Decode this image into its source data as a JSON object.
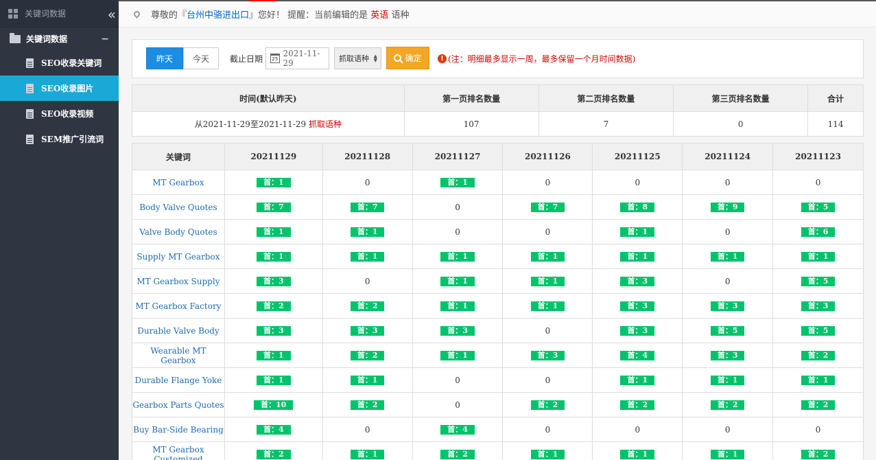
{
  "sidebar": {
    "header_title": "关键词数据",
    "collapse_glyph": "«",
    "group_label": "关键词数据",
    "group_toggle": "−",
    "items": [
      {
        "label": "SEO收录关键词",
        "active": false
      },
      {
        "label": "SEO收录图片",
        "active": true
      },
      {
        "label": "SEO收录视频",
        "active": false
      },
      {
        "label": "SEM推广引流词",
        "active": false
      }
    ]
  },
  "topbar": {
    "greeting_prefix": "尊敬的『",
    "company": "台州中骆进出口",
    "greeting_suffix": "』您好！ 提醒：当前编辑的是 ",
    "language": "英语",
    "language_suffix": " 语种"
  },
  "filter": {
    "yesterday_label": "昨天",
    "today_label": "今天",
    "date_label": "截止日期",
    "date_value": "2021-11-29",
    "calendar_icon_text": "25",
    "select_value": "抓取语种",
    "confirm_label": "确定",
    "note": "(注：明细最多显示一周，最多保留一个月时间数据)"
  },
  "summary": {
    "headers": [
      "时间(默认昨天)",
      "第一页排名数量",
      "第二页排名数量",
      "第三页排名数量",
      "合计"
    ],
    "period_text": "从2021-11-29至2021-11-29 ",
    "period_link": "抓取语种",
    "values": [
      "107",
      "7",
      "0",
      "114"
    ]
  },
  "detail": {
    "headers": [
      "关键词",
      "20211129",
      "20211128",
      "20211127",
      "20211126",
      "20211125",
      "20211124",
      "20211123"
    ],
    "rows": [
      {
        "keyword": "MT Gearbox",
        "cells": [
          "首：1",
          "0",
          "首：1",
          "0",
          "0",
          "0",
          "0"
        ]
      },
      {
        "keyword": "Body Valve Quotes",
        "cells": [
          "首：7",
          "首：7",
          "0",
          "首：7",
          "首：8",
          "首：9",
          "首：5"
        ]
      },
      {
        "keyword": "Valve Body Quotes",
        "cells": [
          "首：1",
          "首：1",
          "0",
          "0",
          "首：1",
          "0",
          "首：6"
        ]
      },
      {
        "keyword": "Supply MT Gearbox",
        "cells": [
          "首：1",
          "首：1",
          "首：1",
          "首：1",
          "首：1",
          "首：1",
          "首：1"
        ]
      },
      {
        "keyword": "MT Gearbox Supply",
        "cells": [
          "首：3",
          "0",
          "首：1",
          "首：1",
          "首：3",
          "0",
          "首：5"
        ]
      },
      {
        "keyword": "MT Gearbox Factory",
        "cells": [
          "首：2",
          "首：2",
          "首：1",
          "首：1",
          "首：3",
          "首：3",
          "首：3"
        ]
      },
      {
        "keyword": "Durable Valve Body",
        "cells": [
          "首：3",
          "首：3",
          "首：3",
          "0",
          "首：3",
          "首：5",
          "首：5"
        ]
      },
      {
        "keyword": "Wearable MT Gearbox",
        "cells": [
          "首：1",
          "首：2",
          "首：1",
          "首：3",
          "首：4",
          "首：3",
          "首：2"
        ]
      },
      {
        "keyword": "Durable Flange Yoke",
        "cells": [
          "首：1",
          "首：1",
          "0",
          "0",
          "首：1",
          "首：1",
          "首：1"
        ]
      },
      {
        "keyword": "Gearbox Parts Quotes",
        "cells": [
          "首：10",
          "首：2",
          "0",
          "首：2",
          "首：2",
          "首：2",
          "首：2"
        ]
      },
      {
        "keyword": "Buy Bar-Side Bearing",
        "cells": [
          "首：4",
          "0",
          "首：4",
          "0",
          "0",
          "0",
          "0"
        ]
      },
      {
        "keyword": "MT Gearbox Customized",
        "cells": [
          "首：2",
          "首：1",
          "首：2",
          "首：1",
          "首：1",
          "首：1",
          "首：2"
        ]
      }
    ]
  },
  "colors": {
    "sidebar_bg": "#2f3642",
    "active_item": "#1aa8d6",
    "primary_button": "#1a8ee5",
    "confirm_button": "#f5a623",
    "badge_green": "#00c36b",
    "alert_red": "#d40000",
    "link_blue": "#1f6bb0"
  }
}
